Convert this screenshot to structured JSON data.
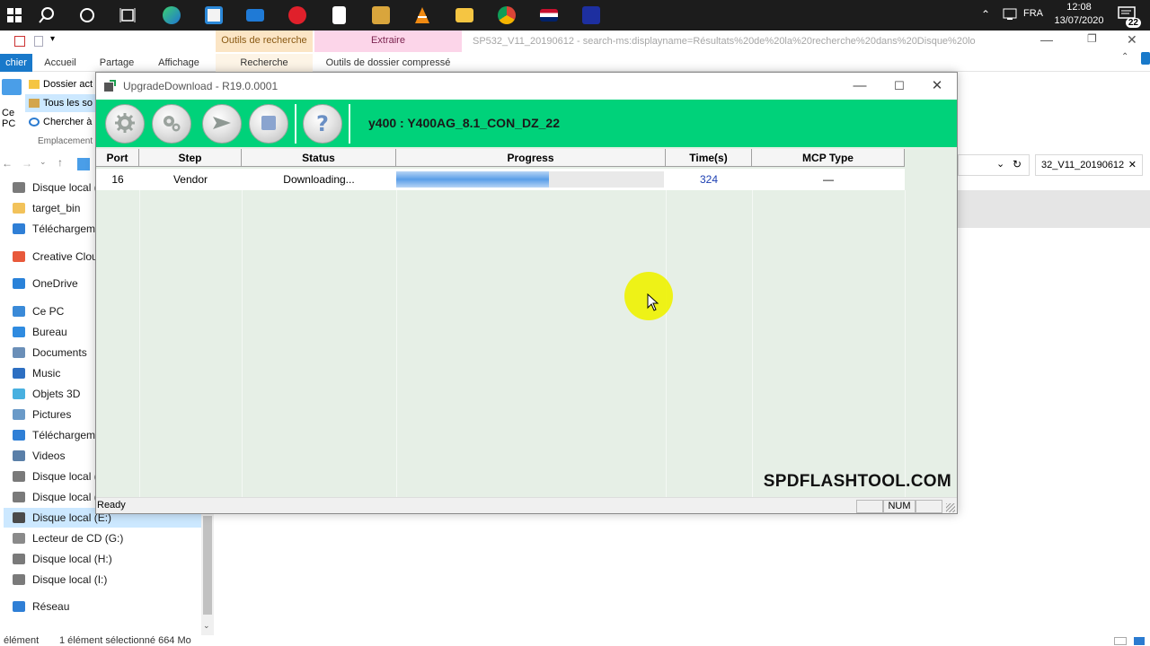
{
  "taskbar": {
    "language": "FRA",
    "time": "12:08",
    "date": "13/07/2020",
    "notifications": "22"
  },
  "explorer": {
    "title": "SP532_V11_20190612 - search-ms:displayname=Résultats%20de%20la%20recherche%20dans%20Disque%20lo",
    "context_tab_search": "Outils de recherche",
    "context_tab_extract": "Extraire",
    "tabs": [
      "chier",
      "Accueil",
      "Partage",
      "Affichage",
      "Recherche",
      "Outils de dossier compressé"
    ],
    "quick": {
      "ce_pc": "Ce PC",
      "dossier": "Dossier act",
      "tous": "Tous les so",
      "chercher": "Chercher à",
      "emplacement": "Emplacement"
    },
    "search_value": "32_V11_20190612",
    "tree": [
      {
        "label": "Disque local (I",
        "color": "#7a7a7a"
      },
      {
        "label": "target_bin",
        "color": "#f2c25a"
      },
      {
        "label": "Téléchargemer",
        "color": "#2f7fd6"
      },
      {
        "label": "Creative Cloud F",
        "color": "#e8593b"
      },
      {
        "label": "OneDrive",
        "color": "#2a82d9"
      },
      {
        "label": "Ce PC",
        "color": "#3a8ad8"
      },
      {
        "label": "Bureau",
        "color": "#2f8be0"
      },
      {
        "label": "Documents",
        "color": "#6b8fb8"
      },
      {
        "label": "Music",
        "color": "#2d6fc2"
      },
      {
        "label": "Objets 3D",
        "color": "#48b0e0"
      },
      {
        "label": "Pictures",
        "color": "#6a9ac8"
      },
      {
        "label": "Téléchargemer",
        "color": "#2f7fd6"
      },
      {
        "label": "Videos",
        "color": "#5a7fa8"
      },
      {
        "label": "Disque local (C",
        "color": "#7a7a7a"
      },
      {
        "label": "Disque local (D",
        "color": "#7a7a7a"
      },
      {
        "label": "Disque local (E:)",
        "color": "#4a4a4a"
      },
      {
        "label": "Lecteur de CD (G:)",
        "color": "#8a8a8a"
      },
      {
        "label": "Disque local (H:)",
        "color": "#7a7a7a"
      },
      {
        "label": "Disque local (I:)",
        "color": "#7a7a7a"
      },
      {
        "label": "Réseau",
        "color": "#2f7fd6"
      }
    ],
    "status_left": "élément",
    "status_selected": "1 élément sélectionné  664 Mo"
  },
  "tool": {
    "title": "UpgradeDownload - R19.0.0001",
    "model": "y400 : Y400AG_8.1_CON_DZ_22",
    "columns": [
      "Port",
      "Step",
      "Status",
      "Progress",
      "Time(s)",
      "MCP Type"
    ],
    "row": {
      "port": "16",
      "step": "Vendor",
      "status": "Downloading...",
      "progress_fraction": 0.57,
      "time": "324",
      "mcp": "—"
    },
    "status_ready": "Ready",
    "status_num": "NUM",
    "watermark": "SPDFLASHTOOL.COM",
    "toolbar_icons": [
      "gear-icon",
      "settings-gears-icon",
      "start-arrow-icon",
      "stop-icon",
      "help-icon"
    ]
  }
}
